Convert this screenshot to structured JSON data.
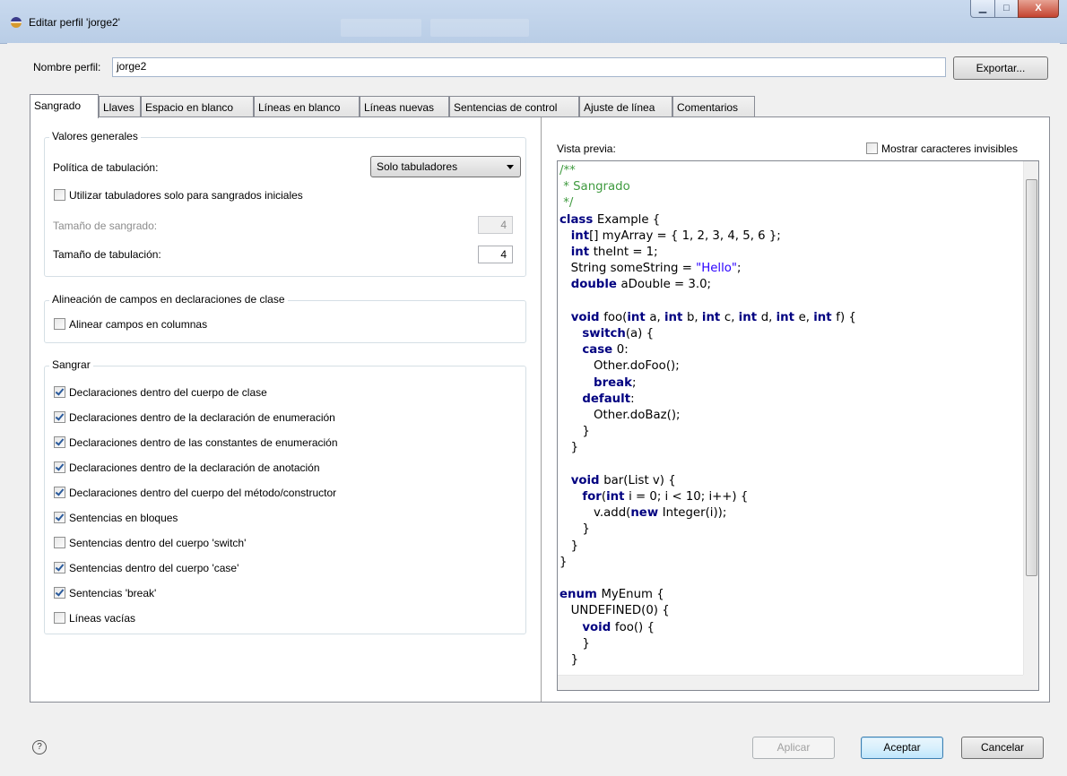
{
  "window": {
    "title": "Editar perfil 'jorge2'",
    "min_glyph": "▁",
    "max_glyph": "□",
    "close_glyph": "X"
  },
  "profile": {
    "label": "Nombre perfil:",
    "value": "jorge2",
    "export_button": "Exportar..."
  },
  "tabs": [
    {
      "label": "Sangrado",
      "active": true
    },
    {
      "label": "Llaves"
    },
    {
      "label": "Espacio en blanco"
    },
    {
      "label": "Líneas en blanco"
    },
    {
      "label": "Líneas nuevas"
    },
    {
      "label": "Sentencias de control"
    },
    {
      "label": "Ajuste de línea"
    },
    {
      "label": "Comentarios"
    }
  ],
  "general": {
    "title": "Valores generales",
    "tab_policy_label": "Política de tabulación:",
    "tab_policy_value": "Solo tabuladores",
    "leading_tabs_label": "Utilizar tabuladores solo para sangrados iniciales",
    "indent_size_label": "Tamaño de sangrado:",
    "indent_size_value": "4",
    "tab_size_label": "Tamaño de tabulación:",
    "tab_size_value": "4"
  },
  "alignment": {
    "title": "Alineación de campos en declaraciones de clase",
    "align_label": "Alinear campos en columnas"
  },
  "indent": {
    "title": "Sangrar",
    "items": [
      {
        "label": "Declaraciones dentro del cuerpo de clase",
        "checked": true
      },
      {
        "label": "Declaraciones dentro de la declaración de enumeración",
        "checked": true
      },
      {
        "label": "Declaraciones dentro de las constantes de enumeración",
        "checked": true
      },
      {
        "label": "Declaraciones dentro de la declaración de anotación",
        "checked": true
      },
      {
        "label": "Declaraciones dentro del cuerpo del método/constructor",
        "checked": true
      },
      {
        "label": "Sentencias en bloques",
        "checked": true
      },
      {
        "label": "Sentencias dentro del cuerpo 'switch'",
        "checked": false
      },
      {
        "label": "Sentencias dentro del cuerpo 'case'",
        "checked": true
      },
      {
        "label": "Sentencias 'break'",
        "checked": true
      },
      {
        "label": "Líneas vacías",
        "checked": false
      }
    ]
  },
  "preview": {
    "label": "Vista previa:",
    "invisible_label": "Mostrar caracteres invisibles",
    "invisible_checked": false,
    "code_lines": [
      [
        [
          "cm",
          "/**"
        ]
      ],
      [
        [
          "cm",
          " * Sangrado"
        ]
      ],
      [
        [
          "cm",
          " */"
        ]
      ],
      [
        [
          "kw",
          "class"
        ],
        [
          "",
          "Example {"
        ]
      ],
      [
        [
          "",
          "   "
        ],
        [
          "kw",
          "int"
        ],
        [
          "",
          "[] myArray = { 1, 2, 3, 4, 5, 6 };"
        ]
      ],
      [
        [
          "",
          "   "
        ],
        [
          "kw",
          "int"
        ],
        [
          "",
          "theInt = 1;"
        ]
      ],
      [
        [
          "",
          "   String someString = "
        ],
        [
          "st",
          "\"Hello\""
        ],
        [
          "",
          ";"
        ]
      ],
      [
        [
          "",
          "   "
        ],
        [
          "kw",
          "double"
        ],
        [
          "",
          "aDouble = 3.0;"
        ]
      ],
      [
        [
          "",
          ""
        ]
      ],
      [
        [
          "",
          "   "
        ],
        [
          "kw",
          "void"
        ],
        [
          "",
          "foo("
        ],
        [
          "kw",
          "int"
        ],
        [
          "",
          "a, "
        ],
        [
          "kw",
          "int"
        ],
        [
          "",
          "b, "
        ],
        [
          "kw",
          "int"
        ],
        [
          "",
          "c, "
        ],
        [
          "kw",
          "int"
        ],
        [
          "",
          "d, "
        ],
        [
          "kw",
          "int"
        ],
        [
          "",
          "e, "
        ],
        [
          "kw",
          "int"
        ],
        [
          "",
          "f) {"
        ]
      ],
      [
        [
          "",
          "      "
        ],
        [
          "kw",
          "switch"
        ],
        [
          "",
          "(a) {"
        ]
      ],
      [
        [
          "",
          "      "
        ],
        [
          "kw",
          "case"
        ],
        [
          "",
          "0:"
        ]
      ],
      [
        [
          "",
          "         Other.doFoo();"
        ]
      ],
      [
        [
          "",
          "         "
        ],
        [
          "kw",
          "break"
        ],
        [
          "",
          ";"
        ]
      ],
      [
        [
          "",
          "      "
        ],
        [
          "kw",
          "default"
        ],
        [
          "",
          ":"
        ]
      ],
      [
        [
          "",
          "         Other.doBaz();"
        ]
      ],
      [
        [
          "",
          "      }"
        ]
      ],
      [
        [
          "",
          "   }"
        ]
      ],
      [
        [
          "",
          ""
        ]
      ],
      [
        [
          "",
          "   "
        ],
        [
          "kw",
          "void"
        ],
        [
          "",
          "bar(List v) {"
        ]
      ],
      [
        [
          "",
          "      "
        ],
        [
          "kw",
          "for"
        ],
        [
          "",
          "("
        ],
        [
          "kw",
          "int"
        ],
        [
          "",
          "i = 0; i < 10; i++) {"
        ]
      ],
      [
        [
          "",
          "         v.add("
        ],
        [
          "kw",
          "new"
        ],
        [
          "",
          "Integer(i));"
        ]
      ],
      [
        [
          "",
          "      }"
        ]
      ],
      [
        [
          "",
          "   }"
        ]
      ],
      [
        [
          "",
          "}"
        ]
      ],
      [
        [
          "",
          ""
        ]
      ],
      [
        [
          "kw",
          "enum"
        ],
        [
          "",
          "MyEnum {"
        ]
      ],
      [
        [
          "",
          "   UNDEFINED(0) {"
        ]
      ],
      [
        [
          "",
          "      "
        ],
        [
          "kw",
          "void"
        ],
        [
          "",
          "foo() {"
        ]
      ],
      [
        [
          "",
          "      }"
        ]
      ],
      [
        [
          "",
          "   }"
        ]
      ]
    ]
  },
  "footer": {
    "help_glyph": "?",
    "apply": "Aplicar",
    "accept": "Aceptar",
    "cancel": "Cancelar"
  }
}
